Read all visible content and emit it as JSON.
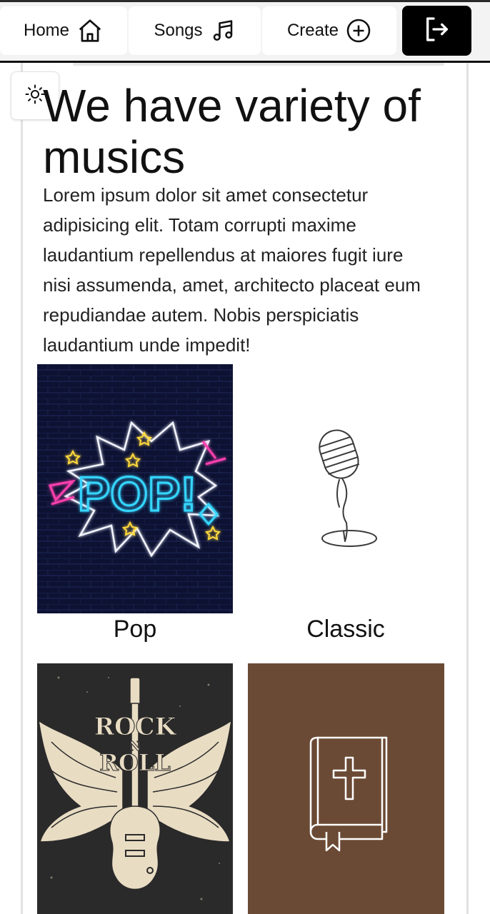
{
  "nav": {
    "home_label": "Home",
    "songs_label": "Songs",
    "create_label": "Create",
    "icons": [
      "home-icon",
      "music-note-icon",
      "plus-circle-icon",
      "logout-icon"
    ]
  },
  "theme_toggle": {
    "icon": "sun-icon"
  },
  "hero": {
    "title": "We have variety of musics",
    "description": "Lorem ipsum dolor sit amet consectetur adipisicing elit. Totam corrupti maxime laudantium repellendus at maiores fugit iure nisi assumenda, amet, architecto placeat eum repudiandae autem. Nobis perspiciatis laudantium unde impedit!"
  },
  "genres": [
    {
      "label": "Pop",
      "image_text": "POP!",
      "icon": "pop-neon-image"
    },
    {
      "label": "Classic",
      "icon": "microphone-icon"
    },
    {
      "label": "",
      "image_text": "ROCK N ROLL",
      "image_lines": [
        "ROCK",
        "N",
        "ROLL"
      ],
      "icon": "rock-guitar-wings-image"
    },
    {
      "label": "",
      "icon": "bible-book-icon"
    }
  ],
  "colors": {
    "logout_bg": "#000000",
    "pop_bg": "#0d1233",
    "neon_blue": "#35d6ff",
    "neon_pink": "#ff3fae",
    "neon_yellow": "#ffd93d",
    "rock_bg": "#2b2a2a",
    "rock_cream": "#e8dcc3",
    "bible_bg": "#6b4a35"
  }
}
